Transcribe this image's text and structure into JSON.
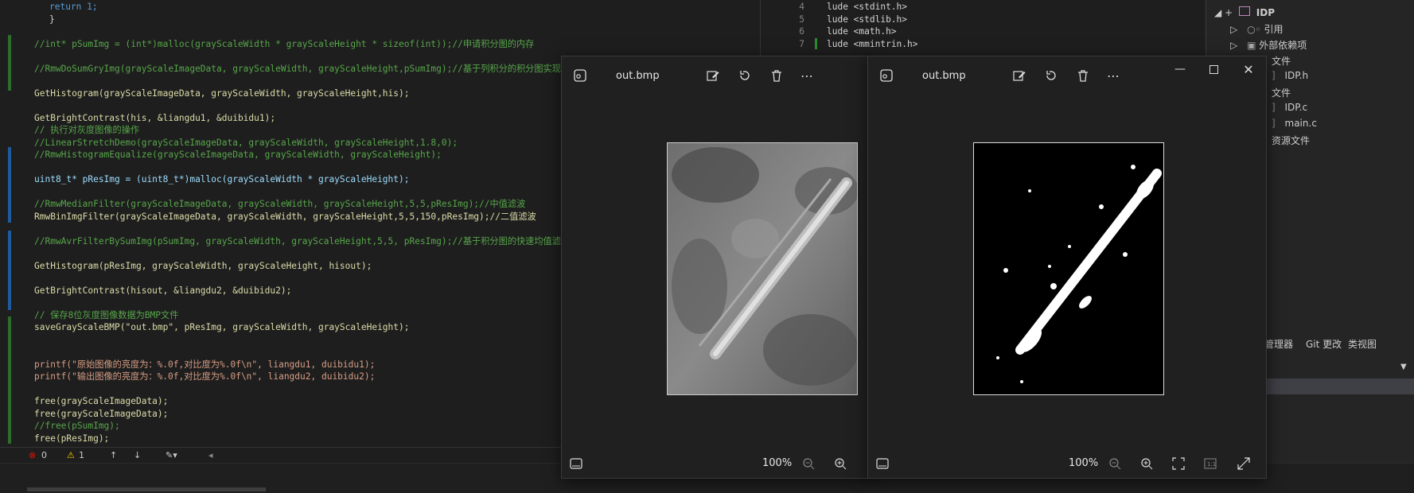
{
  "editor": {
    "lines": [
      {
        "text": "return 1;",
        "cls": "c-kw"
      },
      {
        "text": "}",
        "cls": ""
      },
      {
        "text": "",
        "cls": ""
      },
      {
        "text": "//int* pSumImg = (int*)malloc(grayScaleWidth * grayScaleHeight * sizeof(int));//申请积分图的内存",
        "cls": "c-comment"
      },
      {
        "text": "",
        "cls": ""
      },
      {
        "text": "//RmwDoSumGryImg(grayScaleImageData, grayScaleWidth, grayScaleHeight,pSumImg);//基于列积分的积分图实现",
        "cls": "c-comment"
      },
      {
        "text": "",
        "cls": ""
      },
      {
        "text": "GetHistogram(grayScaleImageData, grayScaleWidth, grayScaleHeight,his);",
        "cls": "c-fn"
      },
      {
        "text": "",
        "cls": ""
      },
      {
        "text": "GetBrightContrast(his, &liangdu1, &duibidu1);",
        "cls": "c-fn"
      },
      {
        "text": "// 执行对灰度图像的操作",
        "cls": "c-comment"
      },
      {
        "text": "//LinearStretchDemo(grayScaleImageData, grayScaleWidth, grayScaleHeight,1.8,0);",
        "cls": "c-comment"
      },
      {
        "text": "//RmwHistogramEqualize(grayScaleImageData, grayScaleWidth, grayScaleHeight);",
        "cls": "c-comment"
      },
      {
        "text": "",
        "cls": ""
      },
      {
        "text": "uint8_t* pResImg = (uint8_t*)malloc(grayScaleWidth * grayScaleHeight);",
        "cls": "c-var"
      },
      {
        "text": "",
        "cls": ""
      },
      {
        "text": "//RmwMedianFilter(grayScaleImageData, grayScaleWidth, grayScaleHeight,5,5,pResImg);//中值滤波",
        "cls": "c-comment"
      },
      {
        "text": "RmwBinImgFilter(grayScaleImageData, grayScaleWidth, grayScaleHeight,5,5,150,pResImg);//二值滤波",
        "cls": "c-fn"
      },
      {
        "text": "",
        "cls": ""
      },
      {
        "text": "//RmwAvrFilterBySumImg(pSumImg, grayScaleWidth, grayScaleHeight,5,5, pResImg);//基于积分图的快速均值滤波",
        "cls": "c-comment"
      },
      {
        "text": "",
        "cls": ""
      },
      {
        "text": "GetHistogram(pResImg, grayScaleWidth, grayScaleHeight, hisout);",
        "cls": "c-fn"
      },
      {
        "text": "",
        "cls": ""
      },
      {
        "text": "GetBrightContrast(hisout, &liangdu2, &duibidu2);",
        "cls": "c-fn"
      },
      {
        "text": "",
        "cls": ""
      },
      {
        "text": "// 保存8位灰度图像数据为BMP文件",
        "cls": "c-comment"
      },
      {
        "text": "saveGrayScaleBMP(\"out.bmp\", pResImg, grayScaleWidth, grayScaleHeight);",
        "cls": "c-fn"
      },
      {
        "text": "",
        "cls": ""
      },
      {
        "text": "",
        "cls": ""
      },
      {
        "text": "printf(\"原始图像的亮度为：%.0f,对比度为%.0f\\n\", liangdu1, duibidu1);",
        "cls": "c-str"
      },
      {
        "text": "printf(\"输出图像的亮度为：%.0f,对比度为%.0f\\n\", liangdu2, duibidu2);",
        "cls": "c-str"
      },
      {
        "text": "",
        "cls": ""
      },
      {
        "text": "free(grayScaleImageData);",
        "cls": "c-fn"
      },
      {
        "text": "free(grayScaleImageData);",
        "cls": "c-fn"
      },
      {
        "text": "//free(pSumImg);",
        "cls": "c-comment"
      },
      {
        "text": "free(pResImg);",
        "cls": "c-fn"
      }
    ],
    "status": {
      "errors": "0",
      "warnings": "1"
    }
  },
  "right_code": {
    "lines": [
      {
        "num": "4",
        "text": "lude <stdint.h>"
      },
      {
        "num": "5",
        "text": "lude <stdlib.h>"
      },
      {
        "num": "6",
        "text": "lude <math.h>"
      },
      {
        "num": "7",
        "text": "lude <mmintrin.h>"
      }
    ]
  },
  "solution": {
    "project": "IDP",
    "references": "引用",
    "external_deps": "外部依赖项",
    "header_files": "文件",
    "idp_h": "IDP.h",
    "source_files": "文件",
    "idp_c": "IDP.c",
    "main_c": "main.c",
    "resource_files": "资源文件",
    "tabs": [
      "管理器",
      "Git 更改",
      "类视图"
    ]
  },
  "viewer_left": {
    "title": "out.bmp",
    "zoom": "100%"
  },
  "viewer_right": {
    "title": "out.bmp",
    "zoom": "100%"
  },
  "colors": {
    "accent": "#007acc",
    "green_bar": "#2d6e2d",
    "error": "#e51400",
    "warning": "#ffcc00"
  }
}
